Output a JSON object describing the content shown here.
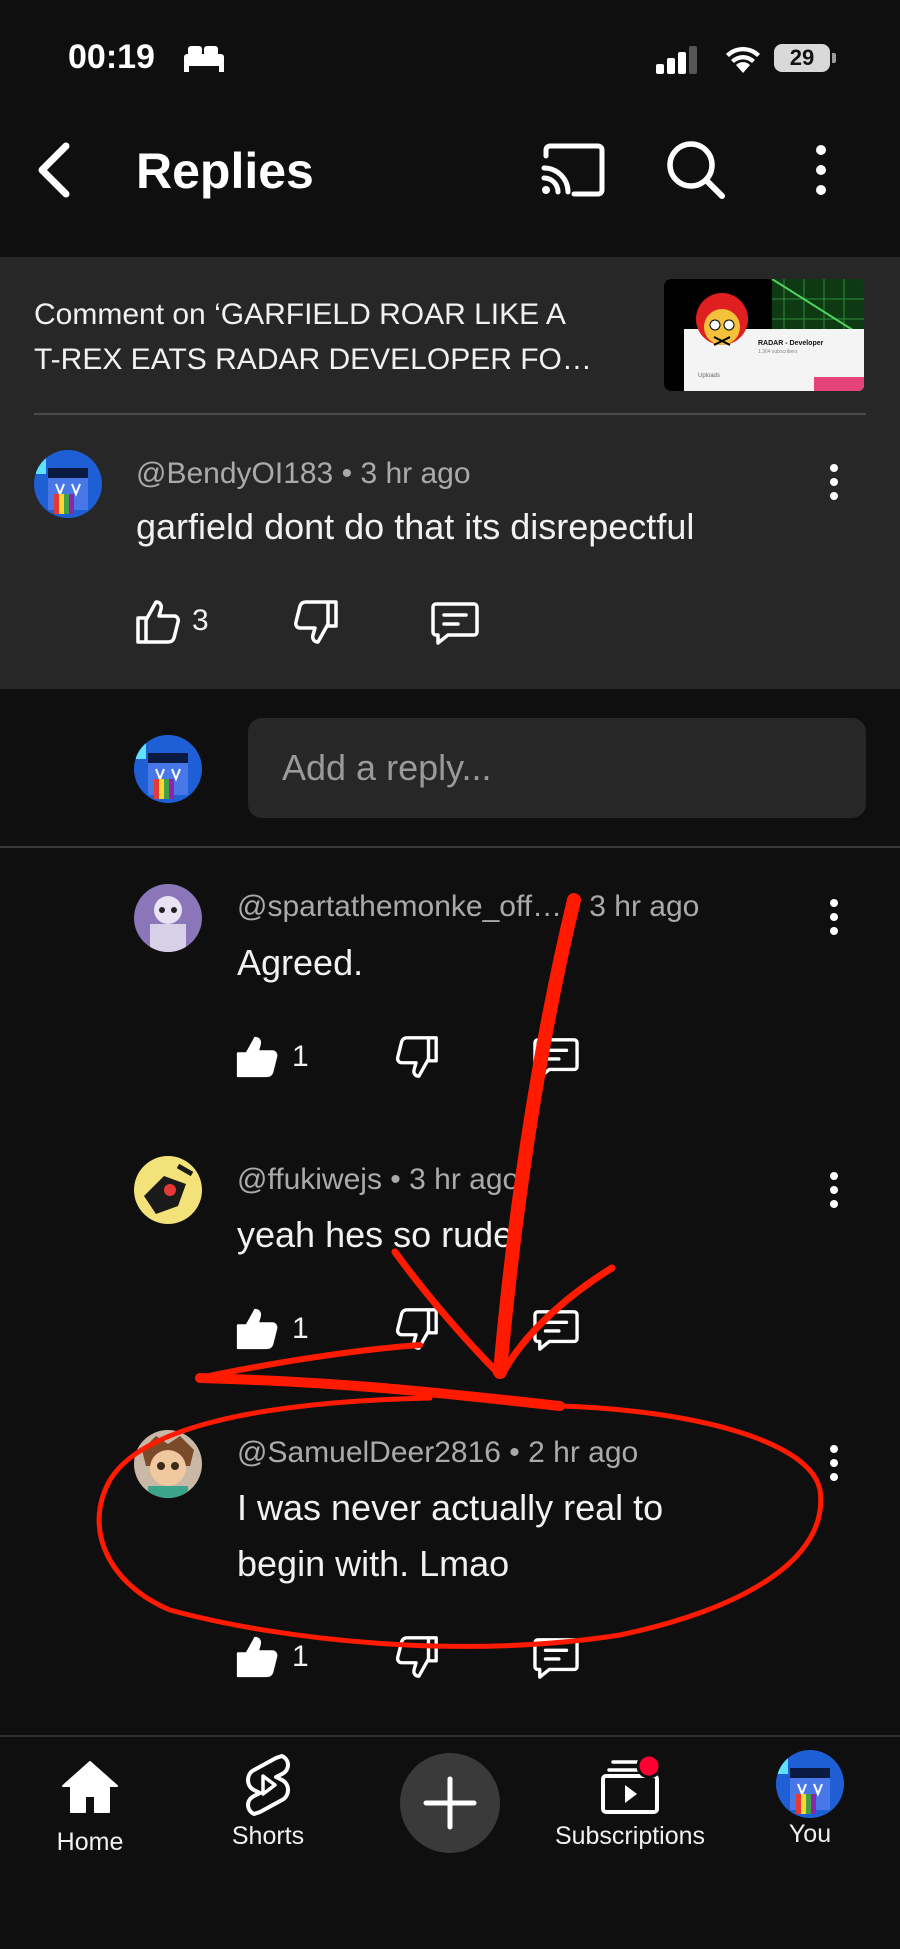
{
  "status_bar": {
    "time": "00:19",
    "battery": "29"
  },
  "header": {
    "title": "Replies"
  },
  "video": {
    "reference_line1": "Comment on ‘GARFIELD ROAR LIKE A",
    "reference_line2": "T-REX EATS RADAR DEVELOPER FO…",
    "thumb_channel": "RADAR - Developer",
    "thumb_subs": "1,364 subscribers",
    "thumb_uploads": "Uploads"
  },
  "parent_comment": {
    "author": "@BendyOI183",
    "time": "3 hr ago",
    "text": "garfield dont do that its disrepectful",
    "likes": "3"
  },
  "reply_box": {
    "placeholder": "Add a reply..."
  },
  "replies": [
    {
      "author": "@spartathemonke_off…",
      "time": "3 hr ago",
      "text": "Agreed.",
      "likes": "1"
    },
    {
      "author": "@ffukiwejs",
      "time": "3 hr ago",
      "text": "yeah hes so rude",
      "likes": "1"
    },
    {
      "author": "@SamuelDeer2816",
      "time": "2 hr ago",
      "text_line1": "I was never actually real to",
      "text_line2": "begin with. Lmao",
      "likes": "1"
    }
  ],
  "separator": "•",
  "nav": {
    "home": "Home",
    "shorts": "Shorts",
    "subscriptions": "Subscriptions",
    "you": "You"
  },
  "colors": {
    "background": "#0f0f0f",
    "surface": "#272727",
    "annotation_red": "#ff1a00",
    "notification_dot": "#ff0033"
  },
  "icons": [
    "back-icon",
    "cast-icon",
    "search-icon",
    "more-vert-icon",
    "like-icon",
    "dislike-icon",
    "reply-icon",
    "home-icon",
    "shorts-icon",
    "plus-icon",
    "subscriptions-icon"
  ]
}
